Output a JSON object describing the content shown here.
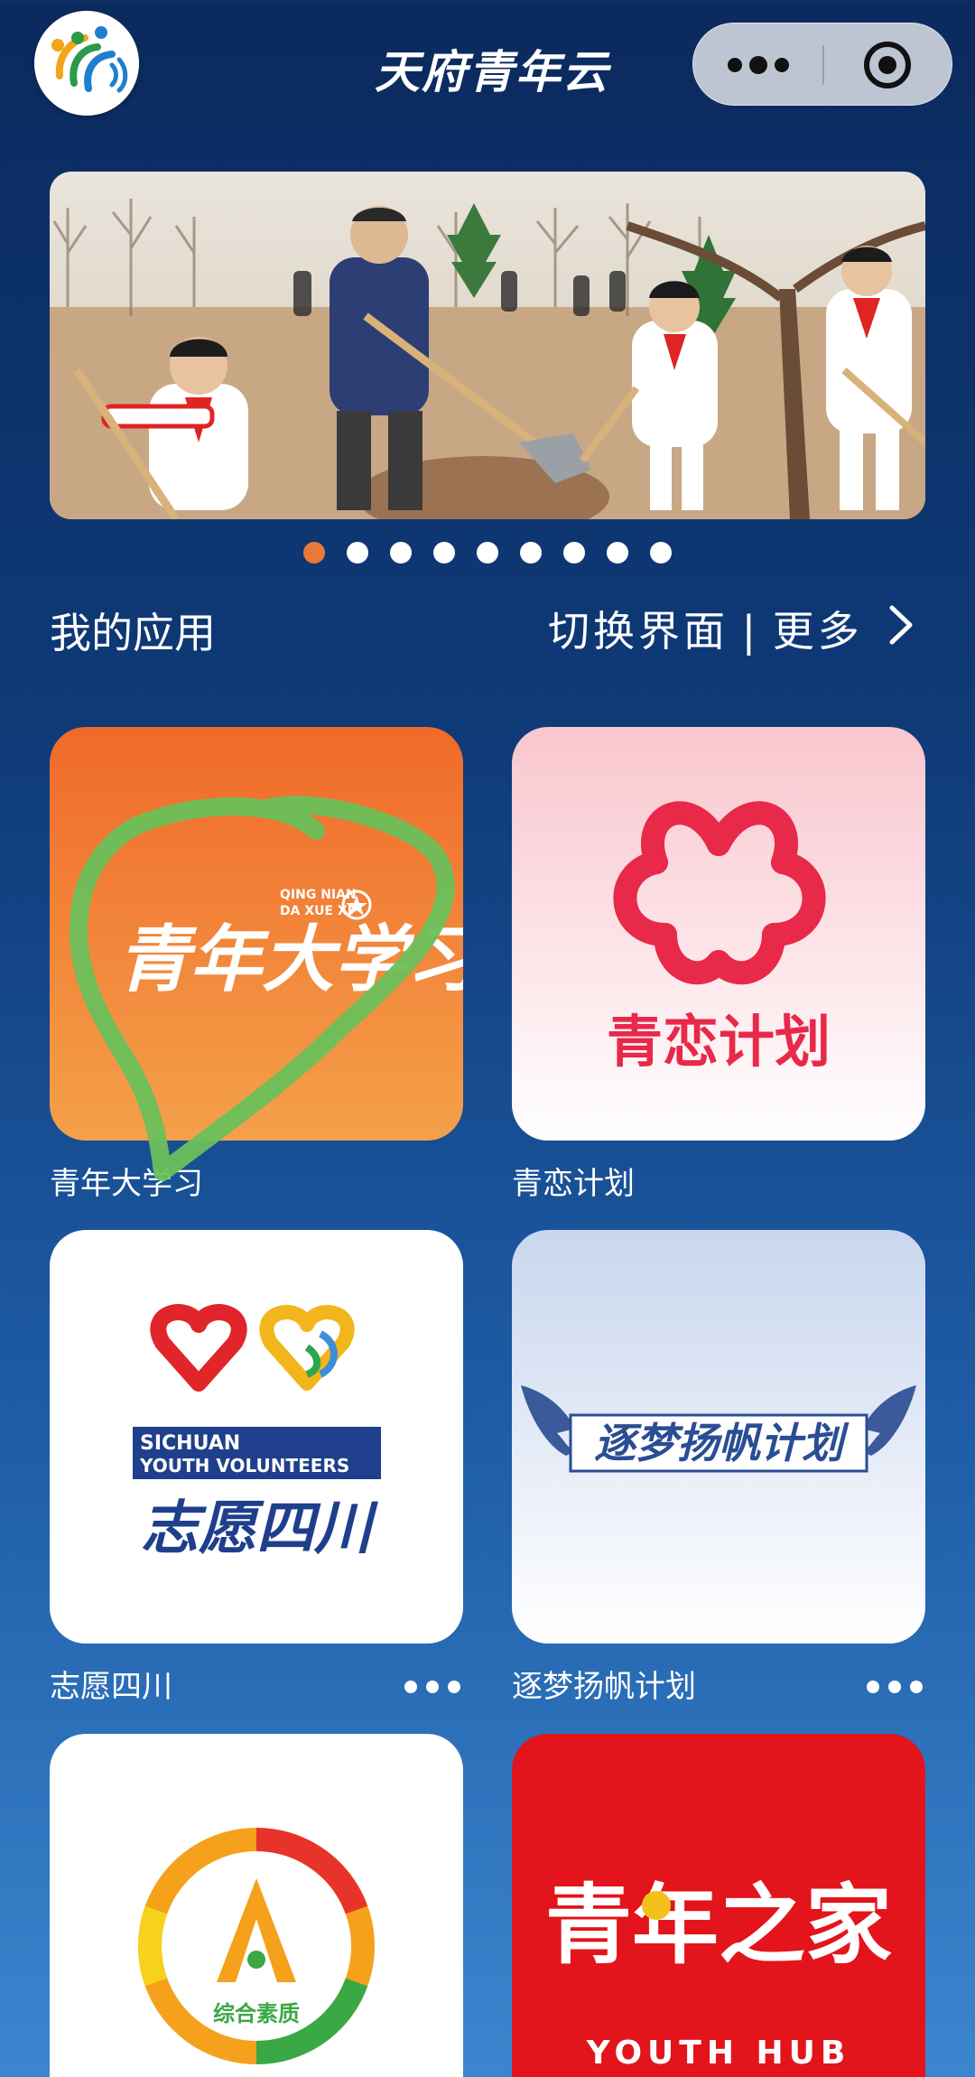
{
  "header": {
    "title": "天府青年云",
    "logo_icon": "tianfu-youth-logo-icon",
    "more_icon": "more-dots-icon",
    "close_icon": "target-close-icon"
  },
  "banner": {
    "image": "tree-planting-photo",
    "slide_count": 9,
    "active_slide": 1,
    "active_dot_color": "#e8793a",
    "dot_color": "#ffffff"
  },
  "section": {
    "title": "我的应用",
    "switch_label": "切换界面",
    "separator": "|",
    "more_label": "更多",
    "chevron_icon": "chevron-right-icon"
  },
  "apps": [
    {
      "label": "青年大学习",
      "tile_text": "青年大学习",
      "tile_small_text_1": "QING NIAN",
      "tile_small_text_2": "DA XUE XI",
      "bg": "#f07a2e",
      "annotation": "green-circle-scribble"
    },
    {
      "label": "青恋计划",
      "tile_text": "青恋计划",
      "bg": "#fde6ea",
      "accent": "#e8294a"
    },
    {
      "label": "志愿四川",
      "tile_text_en_1": "SICHUAN",
      "tile_text_en_2": "YOUTH VOLUNTEERS",
      "tile_text_cn": "志愿四川",
      "bg": "#ffffff",
      "show_more": true
    },
    {
      "label": "逐梦扬帆计划",
      "tile_text": "逐梦扬帆计划",
      "bg": "#dfe6f3",
      "show_more": true
    },
    {
      "label": "综合素质",
      "tile_text": "综合素质",
      "bg": "#ffffff"
    },
    {
      "label": "青年之家",
      "tile_text": "青年之家",
      "tile_text_en": "YOUTH HUB",
      "bg": "#e3141b"
    }
  ]
}
